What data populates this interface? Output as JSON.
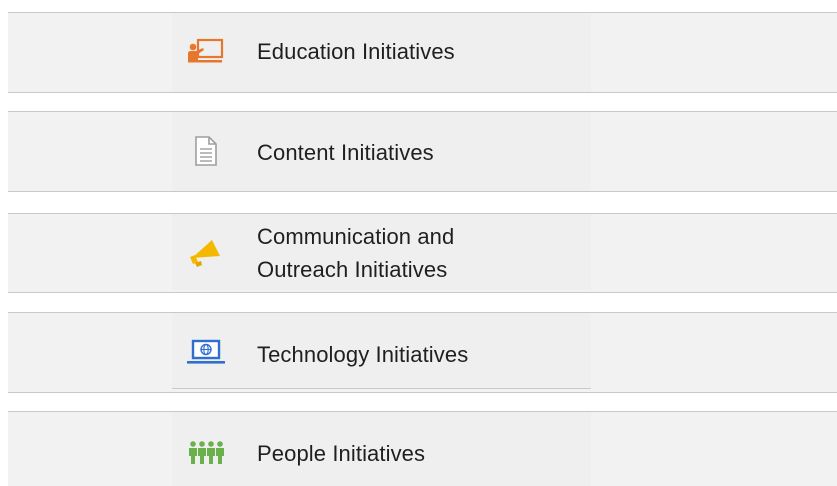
{
  "menu": {
    "items": [
      {
        "label_lines": [
          "Education Initiatives"
        ],
        "icon": "teacher-board-icon",
        "color": "#e8772e"
      },
      {
        "label_lines": [
          "Content Initiatives"
        ],
        "icon": "document-icon",
        "color": "#9e9e9e"
      },
      {
        "label_lines": [
          "Communication and",
          "Outreach Initiatives"
        ],
        "icon": "megaphone-icon",
        "color": "#f5b800"
      },
      {
        "label_lines": [
          "Technology Initiatives"
        ],
        "icon": "laptop-globe-icon",
        "color": "#2f6fd0"
      },
      {
        "label_lines": [
          "People Initiatives"
        ],
        "icon": "people-group-icon",
        "color": "#6ab04c"
      }
    ]
  }
}
